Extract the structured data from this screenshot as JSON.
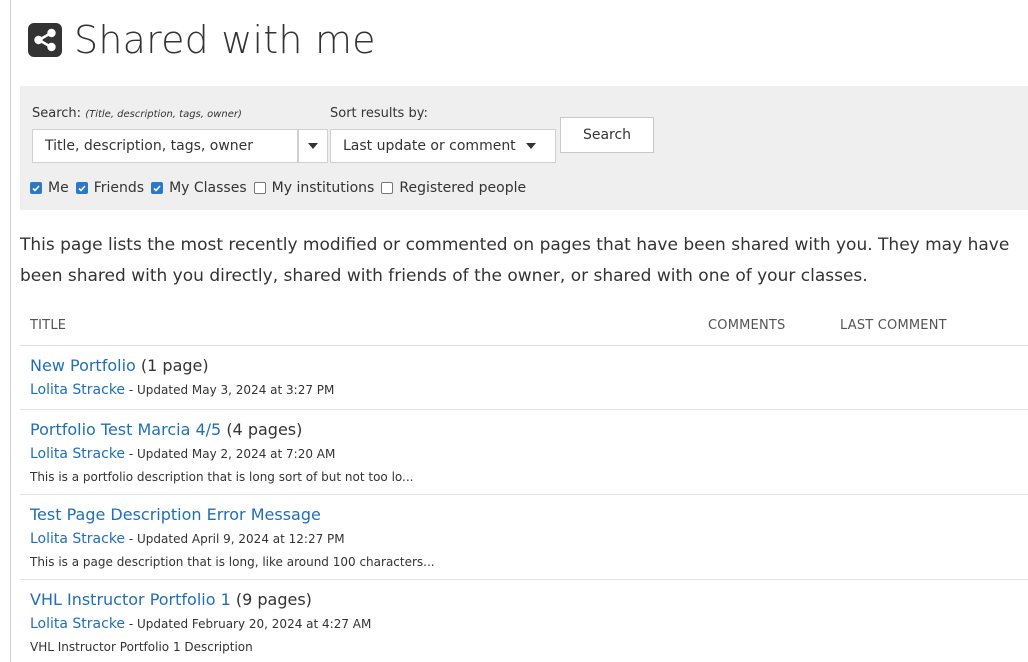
{
  "header": {
    "title": "Shared with me",
    "icon": "share-icon"
  },
  "search": {
    "label": "Search:",
    "hint": "(Title, description, tags, owner)",
    "value": "Title, description, tags, owner",
    "sort_label": "Sort results by:",
    "sort_value": "Last update or comment",
    "button_label": "Search",
    "filters": [
      {
        "label": "Me",
        "checked": true
      },
      {
        "label": "Friends",
        "checked": true
      },
      {
        "label": "My Classes",
        "checked": true
      },
      {
        "label": "My institutions",
        "checked": false
      },
      {
        "label": "Registered people",
        "checked": false
      }
    ]
  },
  "intro": "This page lists the most recently modified or commented on pages that have been shared with you. They may have been shared with you directly, shared with friends of the owner, or shared with one of your classes.",
  "table": {
    "columns": [
      "TITLE",
      "COMMENTS",
      "LAST COMMENT"
    ],
    "rows": [
      {
        "title": "New Portfolio",
        "count": "(1 page)",
        "owner": "Lolita Stracke",
        "updated": "- Updated May 3, 2024 at 3:27 PM",
        "description": ""
      },
      {
        "title": "Portfolio Test Marcia 4/5",
        "count": "(4 pages)",
        "owner": "Lolita Stracke",
        "updated": "- Updated May 2, 2024 at 7:20 AM",
        "description": "This is a portfolio description that is long sort of but not too lo..."
      },
      {
        "title": "Test Page Description Error Message",
        "count": "",
        "owner": "Lolita Stracke",
        "updated": "- Updated April 9, 2024 at 12:27 PM",
        "description": "This is a page description that is long, like around 100 characters..."
      },
      {
        "title": "VHL Instructor Portfolio 1",
        "count": "(9 pages)",
        "owner": "Lolita Stracke",
        "updated": "- Updated February 20, 2024 at 4:27 AM",
        "description": "VHL Instructor Portfolio 1 Description"
      }
    ]
  },
  "colors": {
    "link": "#1f6fb8",
    "checkbox": "#2a78c8",
    "panel": "#efefef"
  }
}
